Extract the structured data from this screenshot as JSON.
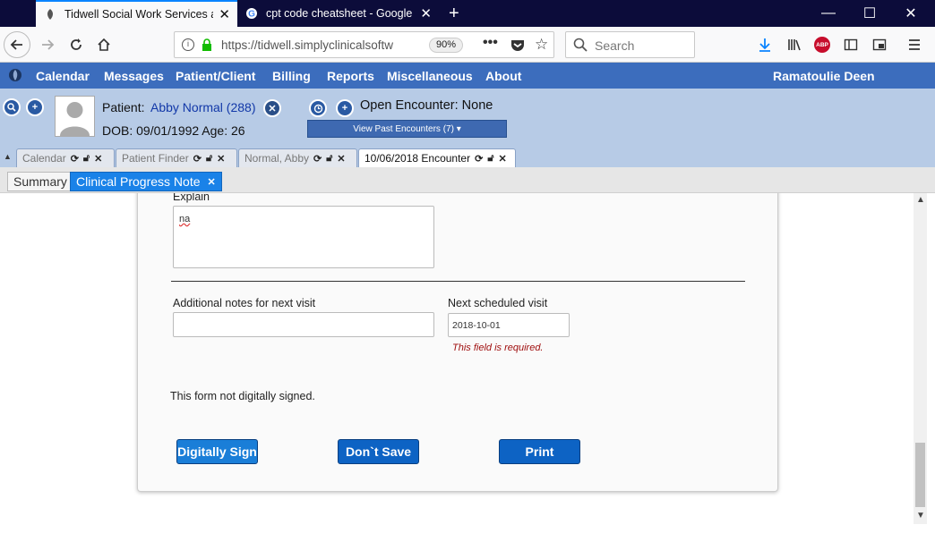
{
  "browser": {
    "tabs": [
      {
        "title": "Tidwell Social Work Services an",
        "active": true
      },
      {
        "title": "cpt code cheatsheet - Google S",
        "active": false
      }
    ],
    "new_tab_label": "+",
    "url": "https://tidwell.simplyclinicalsoftw",
    "zoom": "90%",
    "search_placeholder": "Search",
    "adblock_label": "ABP"
  },
  "app_menu": {
    "items": [
      "Calendar",
      "Messages",
      "Patient/Client",
      "Billing",
      "Reports",
      "Miscellaneous",
      "About"
    ],
    "user": "Ramatoulie Deen"
  },
  "patient": {
    "label": "Patient:",
    "name": "Abby Normal (288)",
    "dob_age": "DOB: 09/01/1992 Age: 26",
    "encounter_status": "Open Encounter: None",
    "past_encounters": "View Past Encounters  (7) ▾"
  },
  "encounter_tabs": [
    {
      "label": "Calendar",
      "active": false
    },
    {
      "label": "Patient Finder",
      "active": false
    },
    {
      "label": "Normal, Abby",
      "active": false
    },
    {
      "label": "10/06/2018 Encounter",
      "active": true
    }
  ],
  "sub_tabs": {
    "summary": "Summary",
    "progress_note": "Clinical Progress Note"
  },
  "form": {
    "explain_label": "Explain",
    "explain_value": "na",
    "notes_label": "Additional notes for next visit",
    "notes_value": "",
    "next_visit_label": "Next scheduled visit",
    "next_visit_value": "2018-10-01",
    "required_msg": "This field is required.",
    "signature_status": "This form not digitally signed.",
    "buttons": {
      "sign": "Digitally Sign",
      "dont_save": "Don`t Save",
      "print": "Print"
    }
  },
  "colors": {
    "menu_bar": "#3c6dbd",
    "patient_bar": "#b7cbe6",
    "active_subtab": "#1a82e8",
    "button": "#0d63c4",
    "error": "#a01010"
  }
}
